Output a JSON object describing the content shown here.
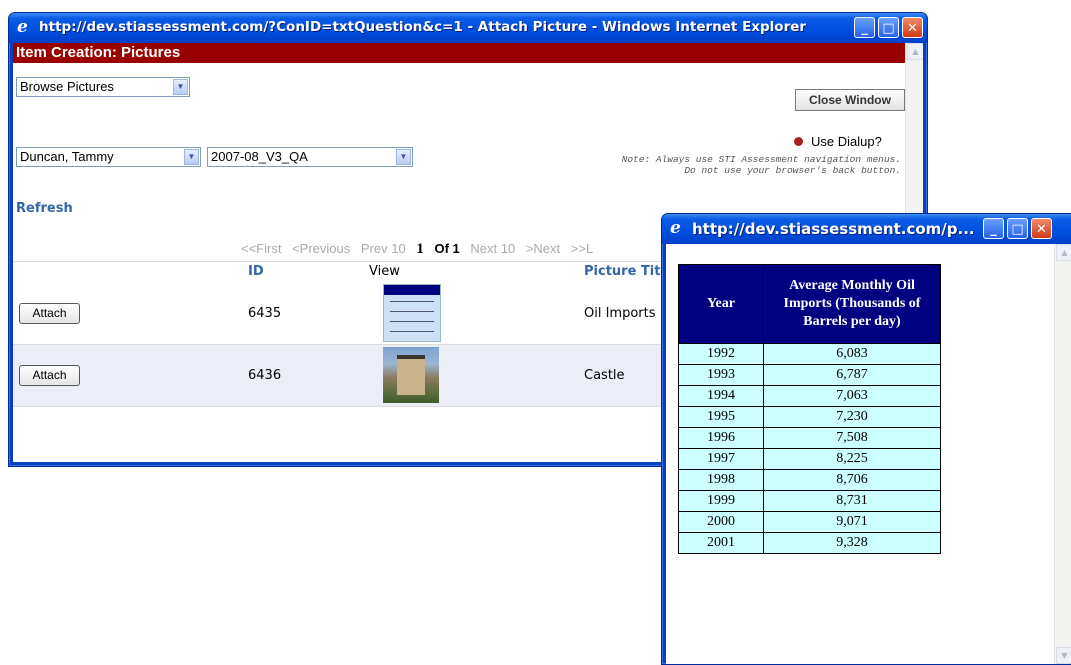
{
  "window1": {
    "title": "http://dev.stiassessment.com/?ConID=txtQuestion&c=1 - Attach Picture - Windows Internet Explorer",
    "header": "Item Creation: Pictures",
    "mode_select": "Browse Pictures",
    "close_window_label": "Close Window",
    "author_select": "Duncan, Tammy",
    "project_select": "2007-08_V3_QA",
    "use_dialup_label": "Use Dialup?",
    "note": "Note: Always use STI Assessment navigation menus. Do not use your browser's back button.",
    "refresh_label": "Refresh",
    "pager": {
      "first": "<<First",
      "previous": "<Previous",
      "prev10": "Prev 10",
      "current": "1",
      "of": "Of 1",
      "next10": "Next 10",
      "next": ">Next",
      "last": ">>L"
    },
    "columns": [
      "ID",
      "View",
      "Picture Tit"
    ],
    "rows": [
      {
        "button": "Attach",
        "id": "6435",
        "title": "Oil Imports"
      },
      {
        "button": "Attach",
        "id": "6436",
        "title": "Castle"
      }
    ]
  },
  "window2": {
    "title": "http://dev.stiassessment.com/p...",
    "table": {
      "col_year": "Year",
      "col_value": "Average Monthly Oil Imports (Thousands of Barrels per day)",
      "rows": [
        {
          "year": "1992",
          "value": "6,083"
        },
        {
          "year": "1993",
          "value": "6,787"
        },
        {
          "year": "1994",
          "value": "7,063"
        },
        {
          "year": "1995",
          "value": "7,230"
        },
        {
          "year": "1996",
          "value": "7,508"
        },
        {
          "year": "1997",
          "value": "8,225"
        },
        {
          "year": "1998",
          "value": "8,706"
        },
        {
          "year": "1999",
          "value": "8,731"
        },
        {
          "year": "2000",
          "value": "9,071"
        },
        {
          "year": "2001",
          "value": "9,328"
        }
      ]
    }
  },
  "colors": {
    "header_bg": "#990000",
    "title_blue": "#0050e0",
    "table_header": "#000080",
    "table_cell": "#ccffff",
    "link": "#3366aa"
  },
  "icons": [
    "ie-logo-icon",
    "minimize-icon",
    "maximize-icon",
    "close-icon",
    "dropdown-arrow-icon",
    "scroll-up-icon",
    "scroll-down-icon",
    "radio-dot-icon"
  ]
}
